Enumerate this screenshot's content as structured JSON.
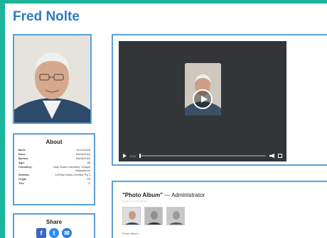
{
  "person": {
    "name": "Fred Nolte"
  },
  "about": {
    "heading": "About",
    "rows": [
      {
        "label": "Born:",
        "value": "11/14/1929"
      },
      {
        "label": "Died:",
        "value": "05/02/2016"
      },
      {
        "label": "Buried:",
        "value": "05/06/2016"
      },
      {
        "label": "Age:",
        "value": "86"
      },
      {
        "label": "Cemetery:",
        "value": "Holy Souls Cemetery, Chapel Mausoleum"
      },
      {
        "label": "Section:",
        "value": "12/Holy Souls Corridor Pg 3"
      },
      {
        "label": "Crypt:",
        "value": "7/9"
      },
      {
        "label": "Tier:",
        "value": "C"
      }
    ]
  },
  "share": {
    "heading": "Share",
    "facebook": "f",
    "twitter": "t",
    "email": "✉"
  },
  "video": {
    "time": "0:00"
  },
  "album": {
    "title": "\"Photo Album\"",
    "by": "— Administrator",
    "subtitle": "Relationship: Administrator",
    "caption": "Photo Album"
  },
  "colors": {
    "accent": "#2f7bbf",
    "border": "#5b9fd6",
    "frame": "#1cb49a"
  }
}
